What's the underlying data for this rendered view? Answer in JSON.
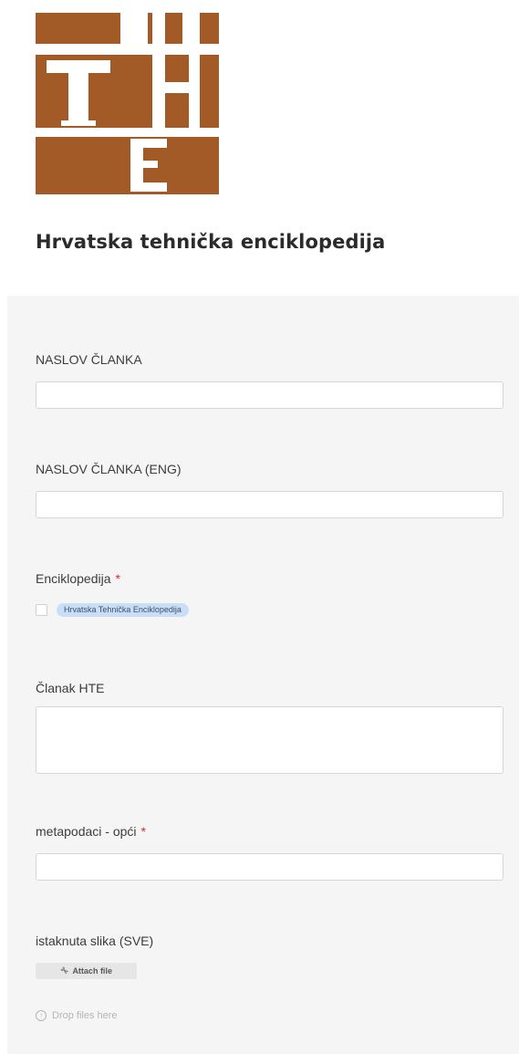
{
  "brand": {
    "logo_letters": "THE",
    "title": "Hrvatska tehnička enciklopedija",
    "logo_color": "#a25a26"
  },
  "form": {
    "fields": {
      "naslov": {
        "label": "NASLOV ČLANKA",
        "value": "",
        "placeholder": ""
      },
      "naslov_eng": {
        "label": "NASLOV ČLANKA (ENG)",
        "value": "",
        "placeholder": ""
      },
      "enciklopedija": {
        "label": "Enciklopedija",
        "required_mark": "*",
        "option_label": "Hrvatska Tehnička Enciklopedija",
        "checked": false
      },
      "clanak": {
        "label": "Članak HTE",
        "value": "",
        "placeholder": ""
      },
      "metapodaci": {
        "label": "metapodaci - opći",
        "required_mark": "*",
        "value": "",
        "placeholder": ""
      },
      "slika": {
        "label": "istaknuta slika (SVE)",
        "attach_label": "Attach file",
        "attach_icon": "paperclip-icon",
        "drop_label": "Drop files here",
        "drop_icon": "upload-circle-icon"
      }
    }
  },
  "colors": {
    "panel_bg": "#f5f5f5",
    "required": "#e02828",
    "tag_bg": "#c9def7"
  }
}
